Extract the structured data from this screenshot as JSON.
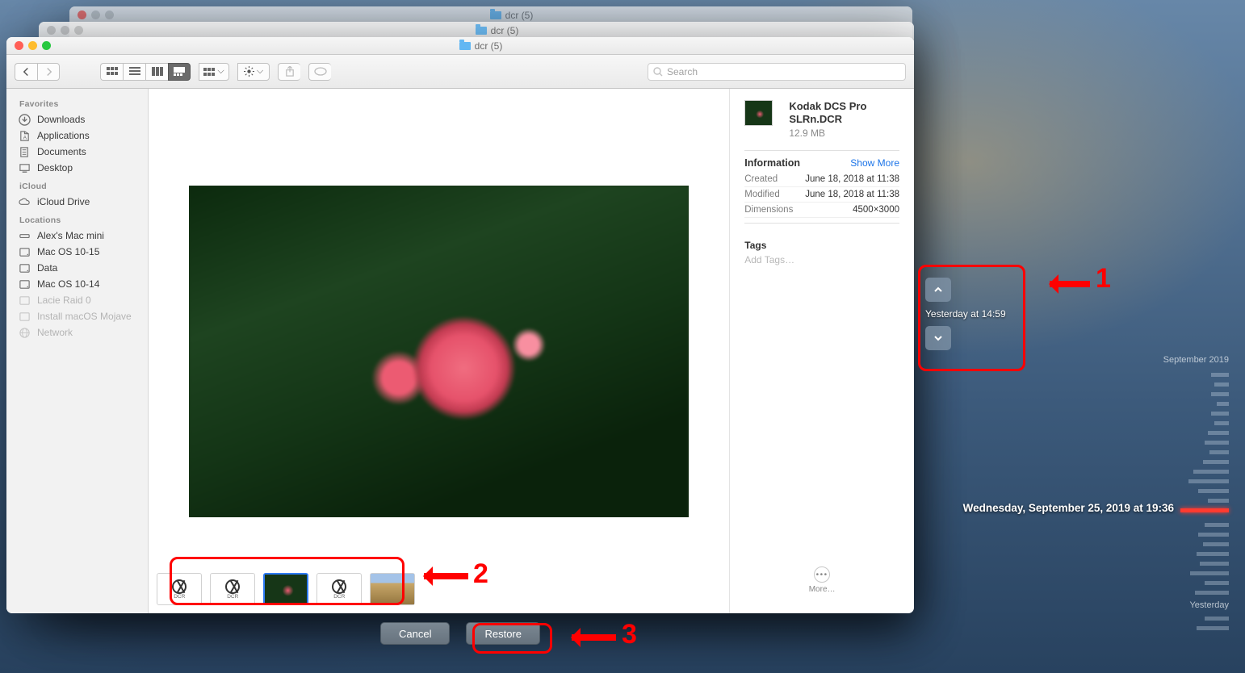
{
  "stacked_title": "dcr (5)",
  "toolbar": {
    "search_placeholder": "Search"
  },
  "sidebar": {
    "sections": [
      {
        "label": "Favorites",
        "items": [
          "Downloads",
          "Applications",
          "Documents",
          "Desktop"
        ]
      },
      {
        "label": "iCloud",
        "items": [
          "iCloud Drive"
        ]
      },
      {
        "label": "Locations",
        "items": [
          "Alex's Mac mini",
          "Mac OS 10-15",
          "Data",
          "Mac OS 10-14",
          "Lacie Raid 0",
          "Install macOS Mojave",
          "Network"
        ]
      }
    ]
  },
  "thumbs": {
    "dcr_label": "DCR"
  },
  "info": {
    "filename": "Kodak DCS Pro SLRn.DCR",
    "filesize": "12.9 MB",
    "section_title": "Information",
    "show_more": "Show More",
    "rows": [
      {
        "k": "Created",
        "v": "June 18, 2018 at 11:38"
      },
      {
        "k": "Modified",
        "v": "June 18, 2018 at 11:38"
      },
      {
        "k": "Dimensions",
        "v": "4500×3000"
      }
    ],
    "tags_title": "Tags",
    "add_tags": "Add Tags…",
    "more_label": "More…"
  },
  "bottombar": {
    "cancel": "Cancel",
    "restore": "Restore"
  },
  "timeline": {
    "nav_label": "Yesterday at 14:59",
    "month_label": "September 2019",
    "yesterday_label": "Yesterday",
    "now_label": "Wednesday, September 25, 2019 at 19:36"
  },
  "annotations": {
    "n1": "1",
    "n2": "2",
    "n3": "3"
  }
}
